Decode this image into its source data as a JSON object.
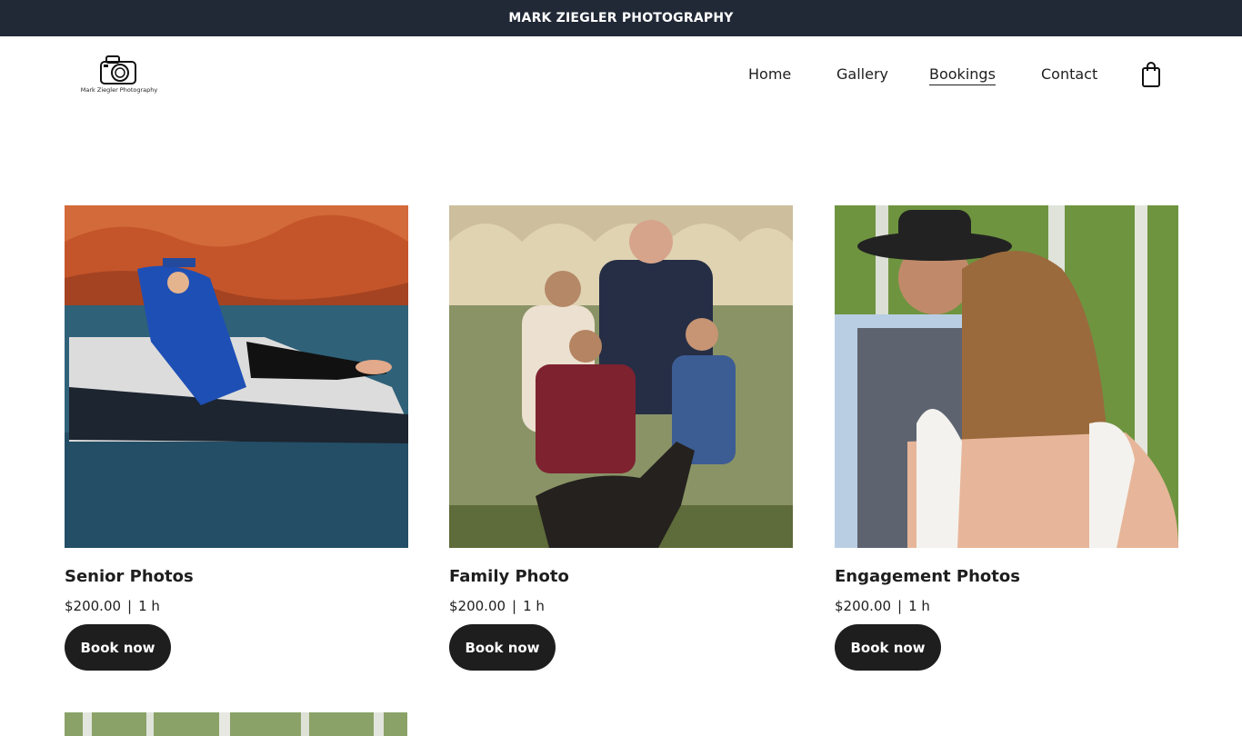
{
  "announcement": "MARK ZIEGLER PHOTOGRAPHY",
  "logo": {
    "text": "Mark Ziegler Photography",
    "icon": "camera-icon"
  },
  "nav": {
    "items": [
      "Home",
      "Gallery",
      "Bookings",
      "Contact"
    ],
    "active": "Bookings",
    "cart_icon": "shopping-bag-icon"
  },
  "services": [
    {
      "title": "Senior Photos",
      "price": "$200.00",
      "separator": "|",
      "duration": "1 h",
      "button": "Book now"
    },
    {
      "title": "Family Photo",
      "price": "$200.00",
      "separator": "|",
      "duration": "1 h",
      "button": "Book now"
    },
    {
      "title": "Engagement Photos",
      "price": "$200.00",
      "separator": "|",
      "duration": "1 h",
      "button": "Book now"
    }
  ],
  "colors": {
    "topbar": "#212836",
    "button": "#1e1e1e",
    "text": "#1e1e1e"
  }
}
